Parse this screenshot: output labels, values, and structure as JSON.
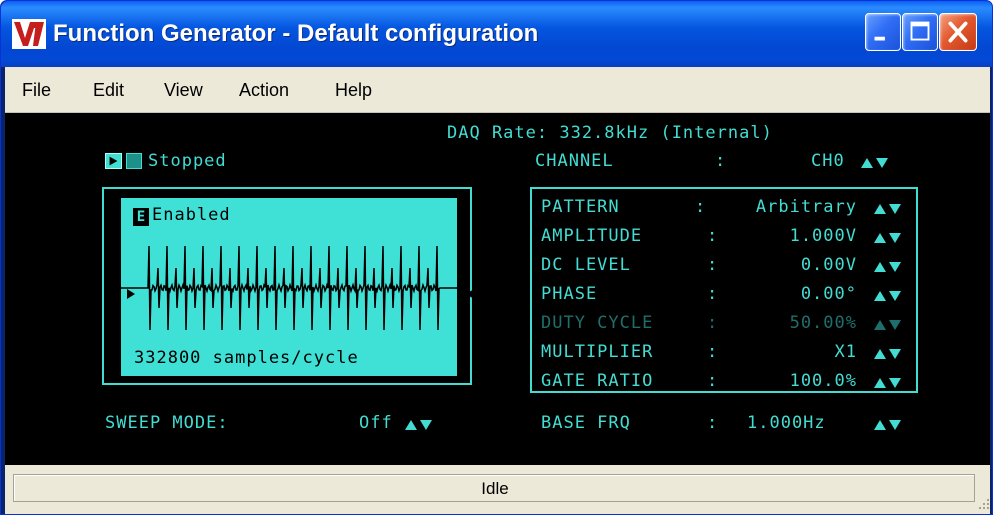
{
  "window": {
    "title": "Function Generator - Default configuration",
    "title_color": "#ffffff",
    "titlebar_color": "#0348d3"
  },
  "menu": {
    "items": [
      "File",
      "Edit",
      "View",
      "Action",
      "Help"
    ]
  },
  "instrument": {
    "accent_color": "#43dcd2",
    "dim_color": "#1e6f6c",
    "background_color": "#000000",
    "daq_rate": "DAQ Rate: 332.8kHz (Internal)",
    "run_icon": "play-icon",
    "stop_icon": "stop-icon",
    "run_status": "Stopped",
    "channel": {
      "label": "CHANNEL",
      "separator": ":",
      "value": "CH0"
    },
    "pattern_display": {
      "enabled_badge": "E",
      "enabled_label": "Enabled",
      "samples_label": "332800 samples/cycle",
      "display_color": "#3fe0d6"
    },
    "params": [
      {
        "label": "PATTERN",
        "separator": ":",
        "value": "Arbitrary",
        "enabled": true
      },
      {
        "label": "AMPLITUDE",
        "separator": ":",
        "value": "1.000V",
        "enabled": true
      },
      {
        "label": "DC LEVEL",
        "separator": ":",
        "value": "0.00V",
        "enabled": true
      },
      {
        "label": "PHASE",
        "separator": ":",
        "value": "0.00°",
        "enabled": true
      },
      {
        "label": "DUTY CYCLE",
        "separator": ":",
        "value": "50.00%",
        "enabled": false
      },
      {
        "label": "MULTIPLIER",
        "separator": ":",
        "value": "X1",
        "enabled": true
      },
      {
        "label": "GATE RATIO",
        "separator": ":",
        "value": "100.0%",
        "enabled": true
      }
    ],
    "sweep_mode": {
      "label": "SWEEP MODE:",
      "value": "Off"
    },
    "base_frq": {
      "label": "BASE FRQ",
      "separator": ":",
      "value": "1.000Hz"
    }
  },
  "statusbar": {
    "text": "Idle"
  }
}
